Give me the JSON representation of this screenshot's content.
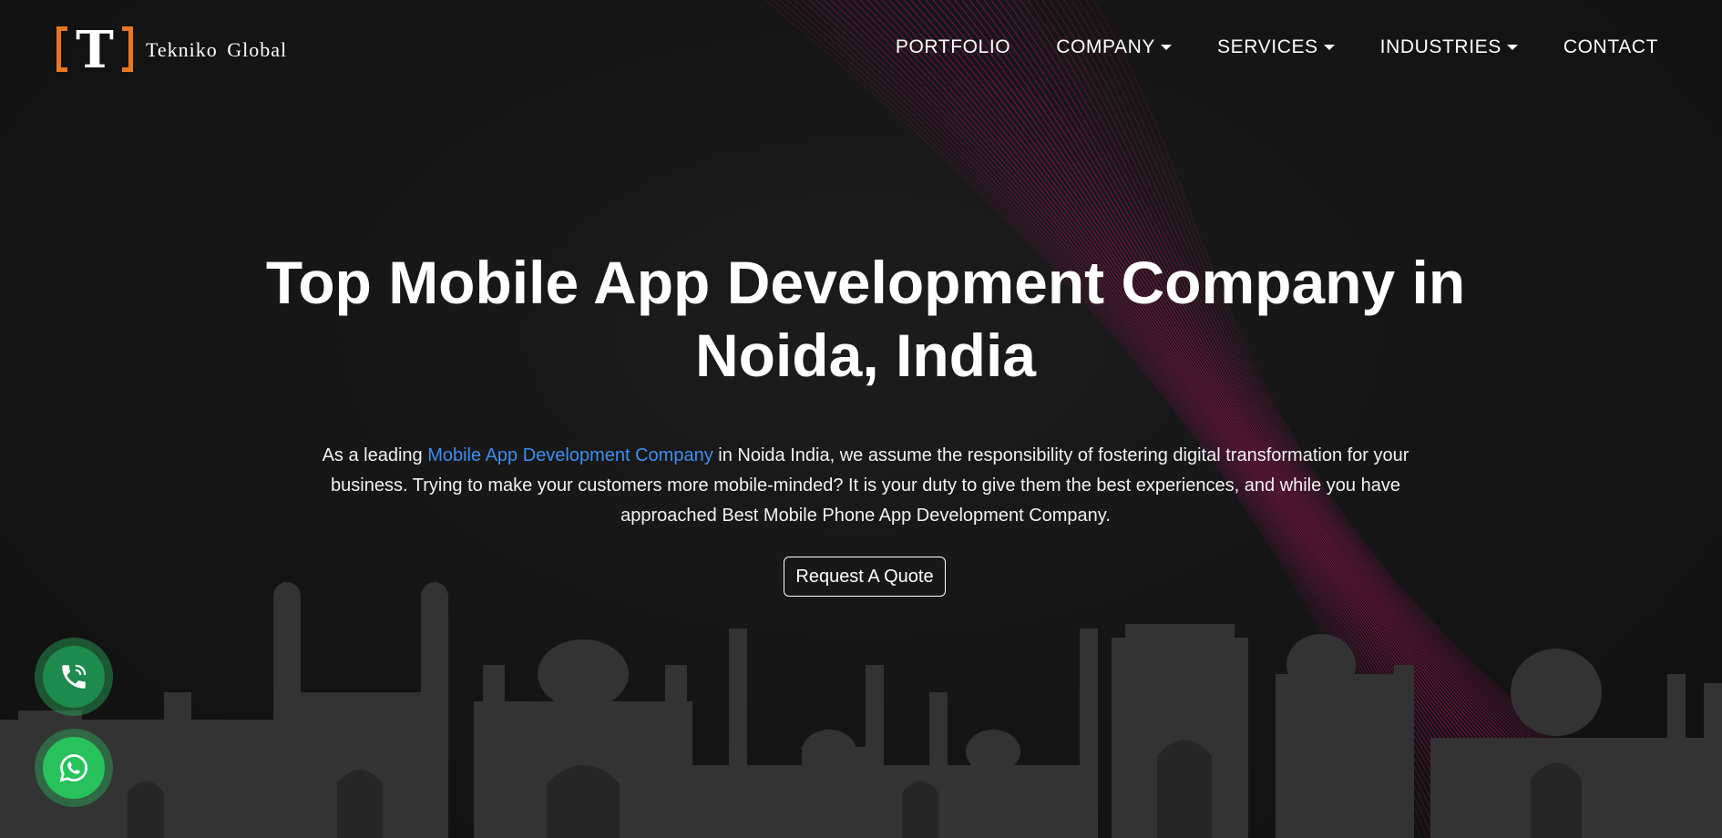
{
  "brand": {
    "logo_letter": "T",
    "name": "Tekniko Global",
    "accent_color": "#e87722"
  },
  "nav": {
    "items": [
      {
        "label": "PORTFOLIO",
        "has_dropdown": false
      },
      {
        "label": "COMPANY",
        "has_dropdown": true
      },
      {
        "label": "SERVICES",
        "has_dropdown": true
      },
      {
        "label": "INDUSTRIES",
        "has_dropdown": true
      },
      {
        "label": "CONTACT",
        "has_dropdown": false
      }
    ]
  },
  "hero": {
    "title_line1": "Top Mobile App Development Company in",
    "title_line2": "Noida, India",
    "desc_before": "As a leading ",
    "desc_link": "Mobile App Development Company",
    "desc_after": " in Noida India, we assume the responsibility of fostering digital transformation for your business. Trying to make your customers more mobile-minded? It is your duty to give them the best experiences, and while you have approached Best Mobile Phone App Development Company.",
    "link_color": "#3d8ef0",
    "cta_label": "Request A Quote"
  },
  "floating": {
    "phone_icon": "phone-call-icon",
    "whatsapp_icon": "whatsapp-icon",
    "phone_color": "#1d8a4e",
    "whatsapp_color": "#27c25c"
  },
  "decor": {
    "wave_color": "#b0135f",
    "skyline_color": "#3a3a3a"
  }
}
